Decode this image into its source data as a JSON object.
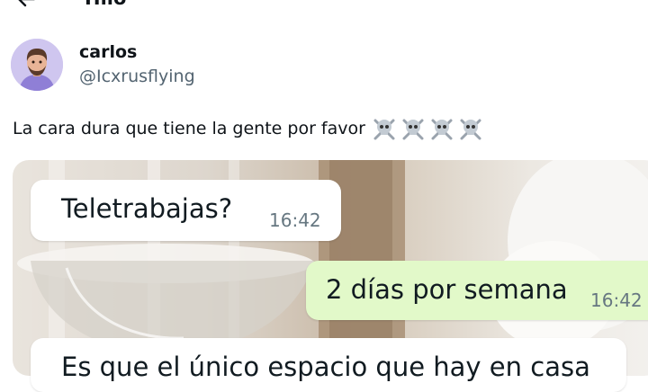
{
  "header": {
    "title": "Hilo",
    "back_icon": "arrow-left-icon"
  },
  "author": {
    "name": "carlos",
    "handle": "@Icxrusflying",
    "avatar_icon": "avatar-illustration"
  },
  "post": {
    "text": "La cara dura que tiene la gente por favor",
    "emoji_icons": [
      "skull-crossbones-icon",
      "skull-crossbones-icon",
      "skull-crossbones-icon",
      "skull-crossbones-icon"
    ]
  },
  "media": {
    "messages": [
      {
        "text": "Teletrabajas?",
        "time": "16:42",
        "direction": "incoming"
      },
      {
        "text": "2 días por semana",
        "time": "16:42",
        "direction": "outgoing"
      },
      {
        "text": "Es que el único espacio que hay en casa",
        "time": "",
        "direction": "incoming"
      }
    ]
  },
  "colors": {
    "incoming_bubble": "#ffffff",
    "outgoing_bubble": "#e2f9c9",
    "handle_text": "#536471",
    "time_text": "#667781"
  }
}
